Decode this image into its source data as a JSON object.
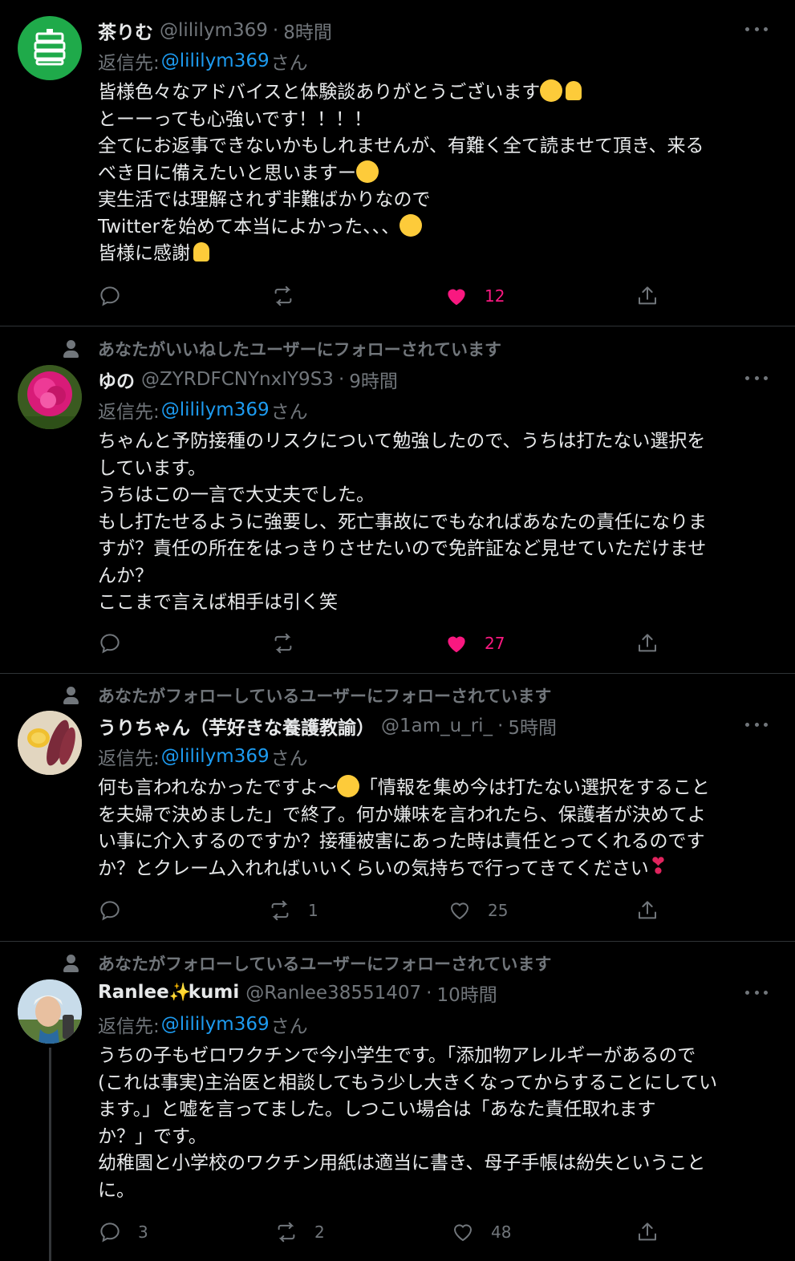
{
  "tweets": [
    {
      "social_context": "",
      "name": "茶りむ",
      "handle": "@lililym369",
      "dot": "·",
      "time": "8時間",
      "reply_prefix": "返信先:",
      "reply_mention": "@lililym369",
      "reply_suffix": "さん",
      "lines": [
        "皆様色々なアドバイスと体験談ありがとうございます",
        "とーーっても心強いです！！！！",
        "全てにお返事できないかもしれませんが、有難く全て読ませて頂き、来る",
        "べき日に備えたいと思いますー",
        "実生活では理解されず非難ばかりなので",
        "Twitterを始めて本当によかった、、、",
        "皆様に感謝"
      ],
      "reply_count": "",
      "retweet_count": "",
      "like_count": "12",
      "liked": true,
      "avatar_icon": "stacked-cups-logo-icon"
    },
    {
      "social_context": "あなたがいいねしたユーザーにフォローされています",
      "name": "ゆの",
      "handle": "@ZYRDFCNYnxIY9S3",
      "dot": "·",
      "time": "9時間",
      "reply_prefix": "返信先:",
      "reply_mention": "@lililym369",
      "reply_suffix": "さん",
      "lines": [
        "ちゃんと予防接種のリスクについて勉強したので、うちは打たない選択を",
        "しています。",
        "うちはこの一言で大丈夫でした。",
        "もし打たせるように強要し、死亡事故にでもなればあなたの責任になりま",
        "すが？責任の所在をはっきりさせたいので免許証など見せていただけませ",
        "んか？",
        "ここまで言えば相手は引く笑"
      ],
      "reply_count": "",
      "retweet_count": "",
      "like_count": "27",
      "liked": true,
      "avatar_icon": "pink-peony-photo"
    },
    {
      "social_context": "あなたがフォローしているユーザーにフォローされています",
      "name": "うりちゃん（芋好きな養護教諭）",
      "handle": "@1am_u_ri_",
      "dot": "·",
      "time": "5時間",
      "reply_prefix": "返信先:",
      "reply_mention": "@lililym369",
      "reply_suffix": "さん",
      "lines": [
        "何も言われなかったですよ〜",
        "「情報を集め今は打たない選択をすること",
        "を夫婦で決めました」で終了。何か嫌味を言われたら、保護者が決めてよ",
        "い事に介入するのですか？接種被害にあった時は責任とってくれるのです",
        "か？とクレーム入れればいいくらいの気持ちで行ってきてください"
      ],
      "reply_count": "",
      "retweet_count": "1",
      "like_count": "25",
      "liked": false,
      "avatar_icon": "sweet-potato-photo"
    },
    {
      "social_context": "あなたがフォローしているユーザーにフォローされています",
      "name_part1": "Ranlee",
      "name_part2": "kumi",
      "handle": "@Ranlee38551407",
      "dot": "·",
      "time": "10時間",
      "reply_prefix": "返信先:",
      "reply_mention": "@lililym369",
      "reply_suffix": "さん",
      "lines": [
        "うちの子もゼロワクチンで今小学生です。「添加物アレルギーがあるので",
        "(これは事実)主治医と相談してもう少し大きくなってからすることにしてい",
        "ます。」と嘘を言ってました。しつこい場合は「あなた責任取れます",
        "か？」です。",
        "幼稚園と小学校のワクチン用紙は適当に書き、母子手帳は紛失ということ",
        "に。"
      ],
      "reply_count": "3",
      "retweet_count": "2",
      "like_count": "48",
      "liked": false,
      "avatar_icon": "person-selfie-photo"
    }
  ],
  "colors": {
    "background": "#000000",
    "text": "#e7e9ea",
    "secondary": "#71767b",
    "link": "#1d9bf0",
    "like": "#f91880",
    "divider": "#2f3336"
  }
}
